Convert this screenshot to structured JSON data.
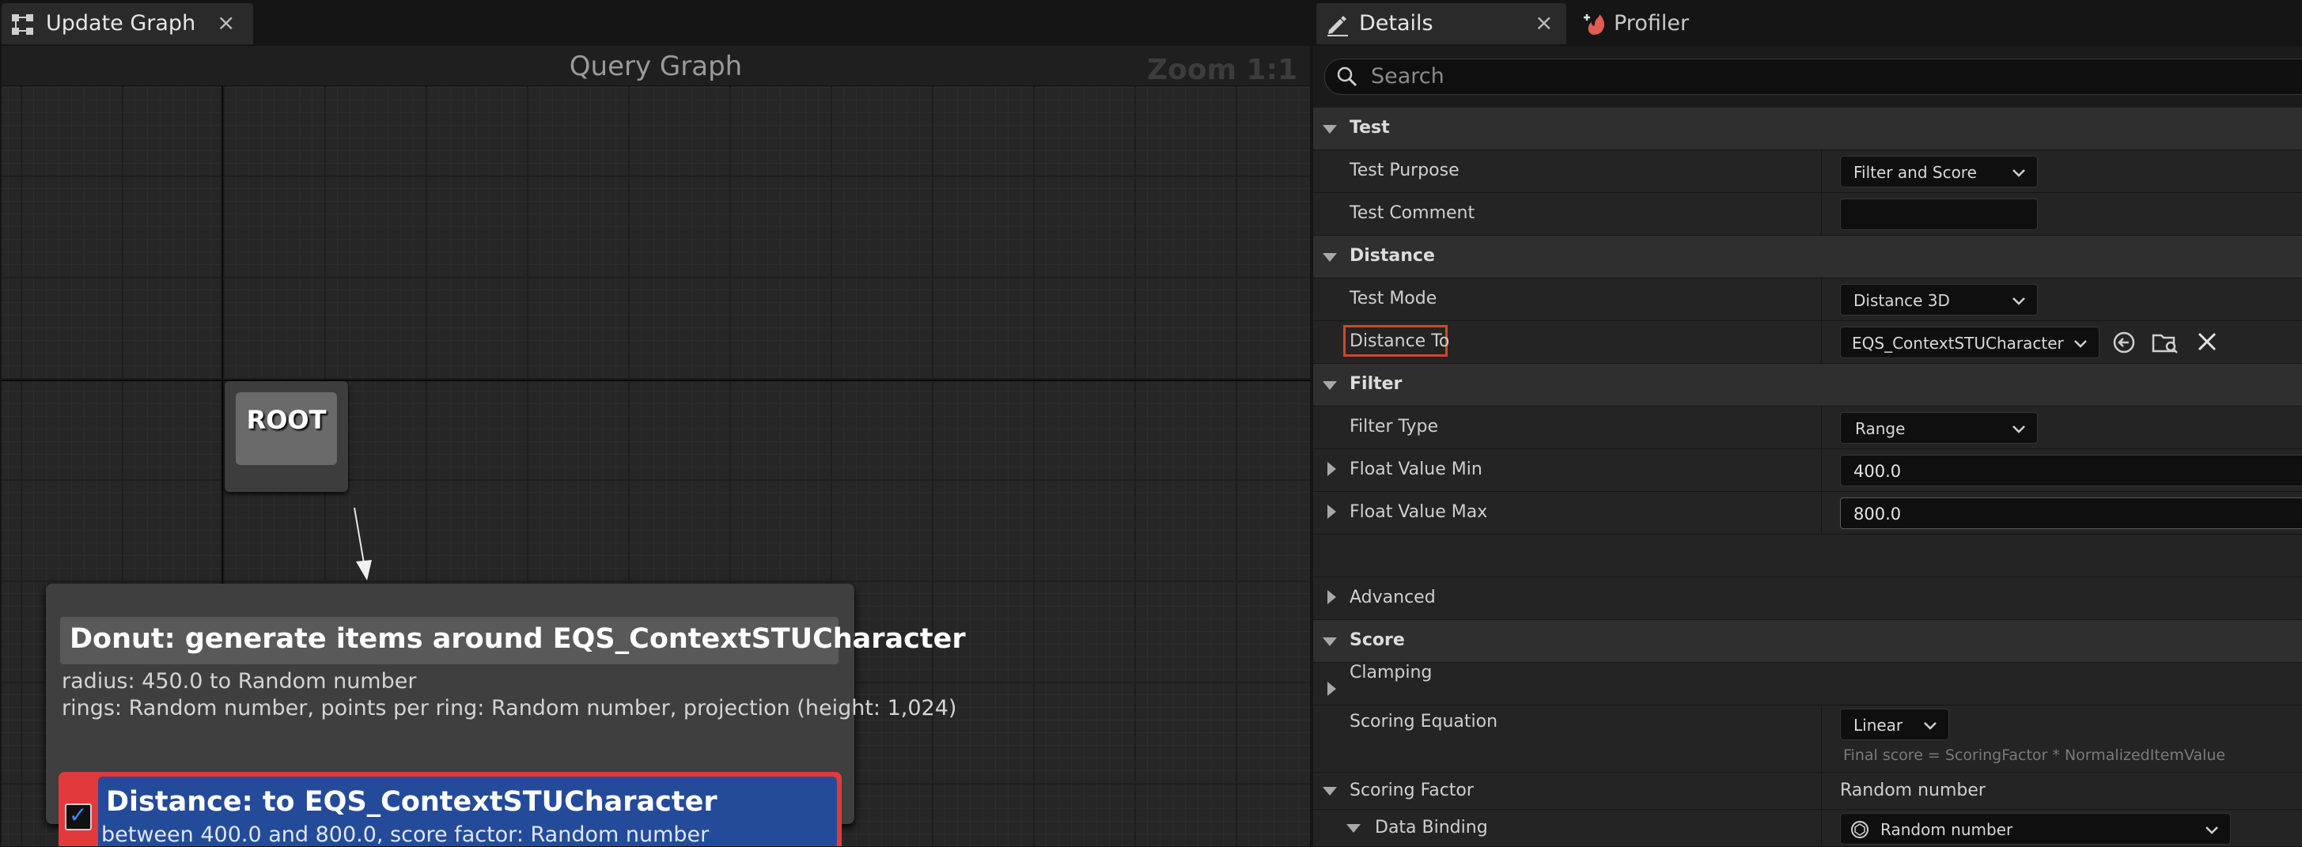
{
  "left_tab": {
    "label": "Update Graph",
    "close": "×",
    "icon": "graph-icon"
  },
  "graph": {
    "title": "Query Graph",
    "zoom": "Zoom 1:1",
    "root_label": "ROOT",
    "donut": {
      "title": "Donut: generate items around EQS_ContextSTUCharacter",
      "line1": "radius: 450.0 to Random number",
      "line2": "rings: Random number, points per ring: Random number, projection (height: 1,024)"
    },
    "distance": {
      "title": "Distance: to EQS_ContextSTUCharacter",
      "line": "between 400.0 and 800.0, score factor: Random number",
      "checked": true
    }
  },
  "right_tabs": {
    "details_label": "Details",
    "details_close": "×",
    "profiler_label": "Profiler"
  },
  "search": {
    "placeholder": "Search"
  },
  "details": {
    "cat_test": "Test",
    "test_purpose_label": "Test Purpose",
    "test_purpose_value": "Filter and Score",
    "test_comment_label": "Test Comment",
    "test_comment_value": "",
    "cat_distance": "Distance",
    "test_mode_label": "Test Mode",
    "test_mode_value": "Distance 3D",
    "distance_to_label": "Distance To",
    "distance_to_value": "EQS_ContextSTUCharacter",
    "cat_filter": "Filter",
    "filter_type_label": "Filter Type",
    "filter_type_value": "Range",
    "float_min_label": "Float Value Min",
    "float_min_value": "400.0",
    "float_max_label": "Float Value Max",
    "float_max_value": "800.0",
    "advanced_label": "Advanced",
    "cat_score": "Score",
    "clamping_label": "Clamping",
    "scoring_eq_label": "Scoring Equation",
    "scoring_eq_value": "Linear",
    "final_score_note": "Final score = ScoringFactor * NormalizedItemValue",
    "scoring_factor_label": "Scoring Factor",
    "scoring_factor_value": "Random number",
    "data_binding_label": "Data Binding",
    "data_binding_value": "Random number"
  },
  "colors": {
    "accent_red": "#e23a3a",
    "node_blue": "#244b9a",
    "highlight_outline": "#c94a2c",
    "checkbox_blue": "#3d8bff"
  }
}
